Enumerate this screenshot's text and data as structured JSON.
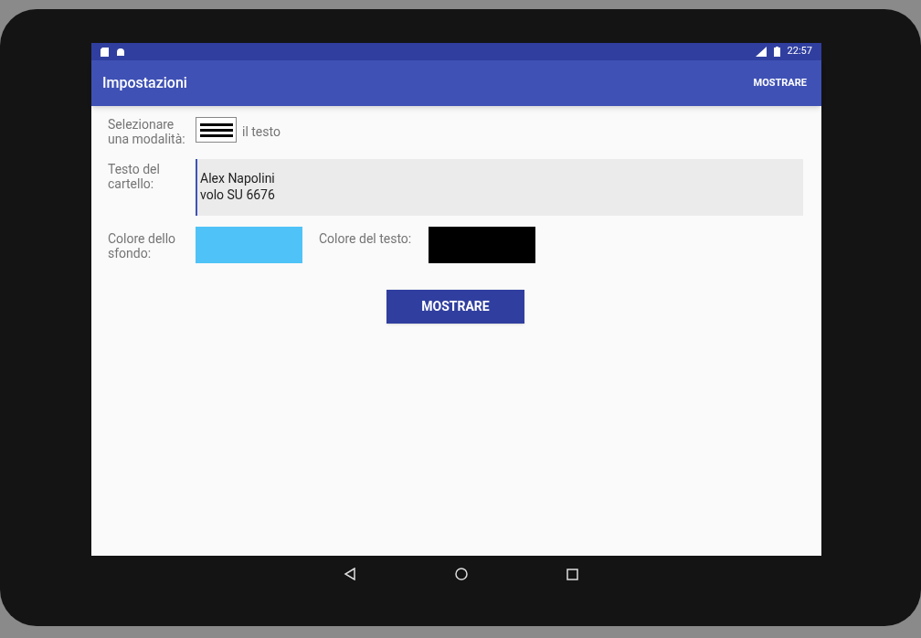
{
  "status_bar": {
    "time": "22:57"
  },
  "app_bar": {
    "title": "Impostazioni",
    "action": "MOSTRARE"
  },
  "mode": {
    "label": "Selezionare una modalità:",
    "option": "il testo"
  },
  "sign_text": {
    "label": "Testo del cartello:",
    "value": "Alex Napolini\nvolo SU 6676"
  },
  "colors": [
    {
      "label": "Colore dello sfondo:",
      "color": "#4fc3f7"
    },
    {
      "label": "Colore del testo:",
      "color": "#000000"
    }
  ],
  "button": "MOSTRARE"
}
